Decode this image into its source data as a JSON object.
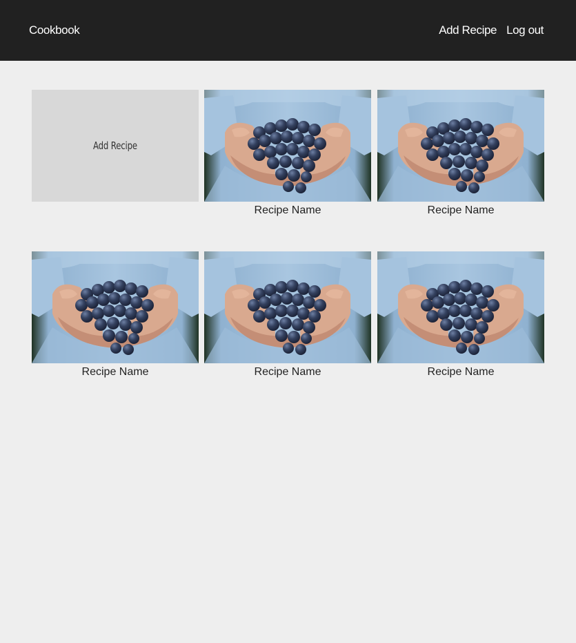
{
  "navbar": {
    "brand": "Cookbook",
    "links": [
      "Add Recipe",
      "Log out"
    ]
  },
  "grid": {
    "add_card_label": "Add Recipe",
    "recipes": [
      {
        "name": "Recipe Name",
        "image": "hands-holding-grapes"
      },
      {
        "name": "Recipe Name",
        "image": "hands-holding-grapes"
      },
      {
        "name": "Recipe Name",
        "image": "hands-holding-grapes"
      },
      {
        "name": "Recipe Name",
        "image": "hands-holding-grapes"
      },
      {
        "name": "Recipe Name",
        "image": "hands-holding-grapes"
      }
    ]
  },
  "colors": {
    "navbar_bg": "#212121",
    "page_bg": "#eeeeee",
    "add_card_bg": "#d8d8d8",
    "shirt_blue": "#a9c6e0",
    "grape": "#2b3550"
  }
}
